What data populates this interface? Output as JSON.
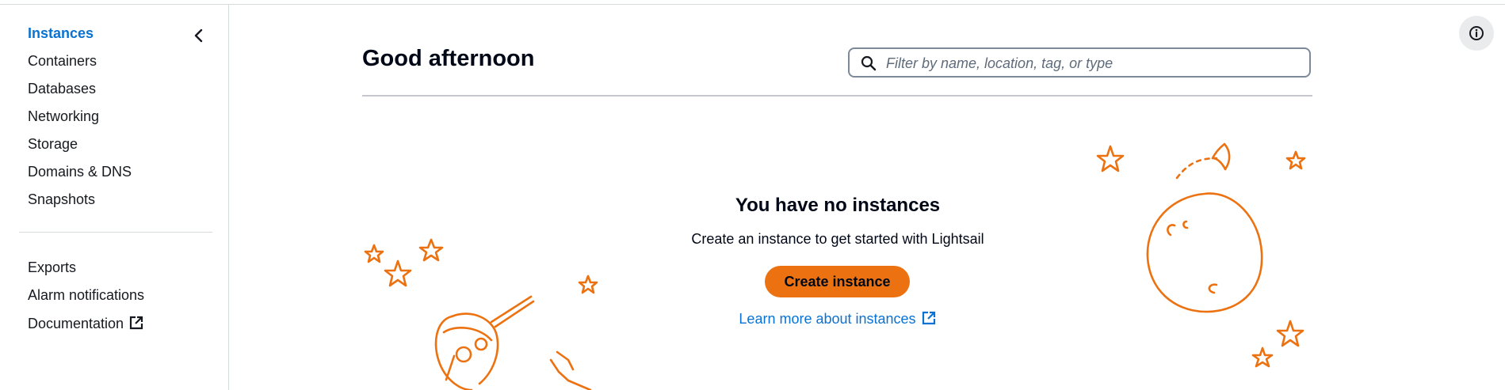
{
  "sidebar": {
    "items": [
      {
        "label": "Instances",
        "active": true
      },
      {
        "label": "Containers"
      },
      {
        "label": "Databases"
      },
      {
        "label": "Networking"
      },
      {
        "label": "Storage"
      },
      {
        "label": "Domains & DNS"
      },
      {
        "label": "Snapshots"
      }
    ],
    "secondary_items": [
      {
        "label": "Exports"
      },
      {
        "label": "Alarm notifications"
      },
      {
        "label": "Documentation",
        "external": true
      }
    ],
    "collapse_icon": "chevron-left-icon"
  },
  "header": {
    "greeting": "Good afternoon",
    "search": {
      "placeholder": "Filter by name, location, tag, or type",
      "value": "",
      "icon": "search-icon"
    }
  },
  "empty_state": {
    "title": "You have no instances",
    "subtitle": "Create an instance to get started with Lightsail",
    "create_button": "Create instance",
    "learn_more": "Learn more about instances"
  },
  "info_icon": "info-icon",
  "colors": {
    "accent": "#ec7211",
    "link": "#0972d3",
    "text": "#16191f",
    "border": "#d5dbdb"
  }
}
